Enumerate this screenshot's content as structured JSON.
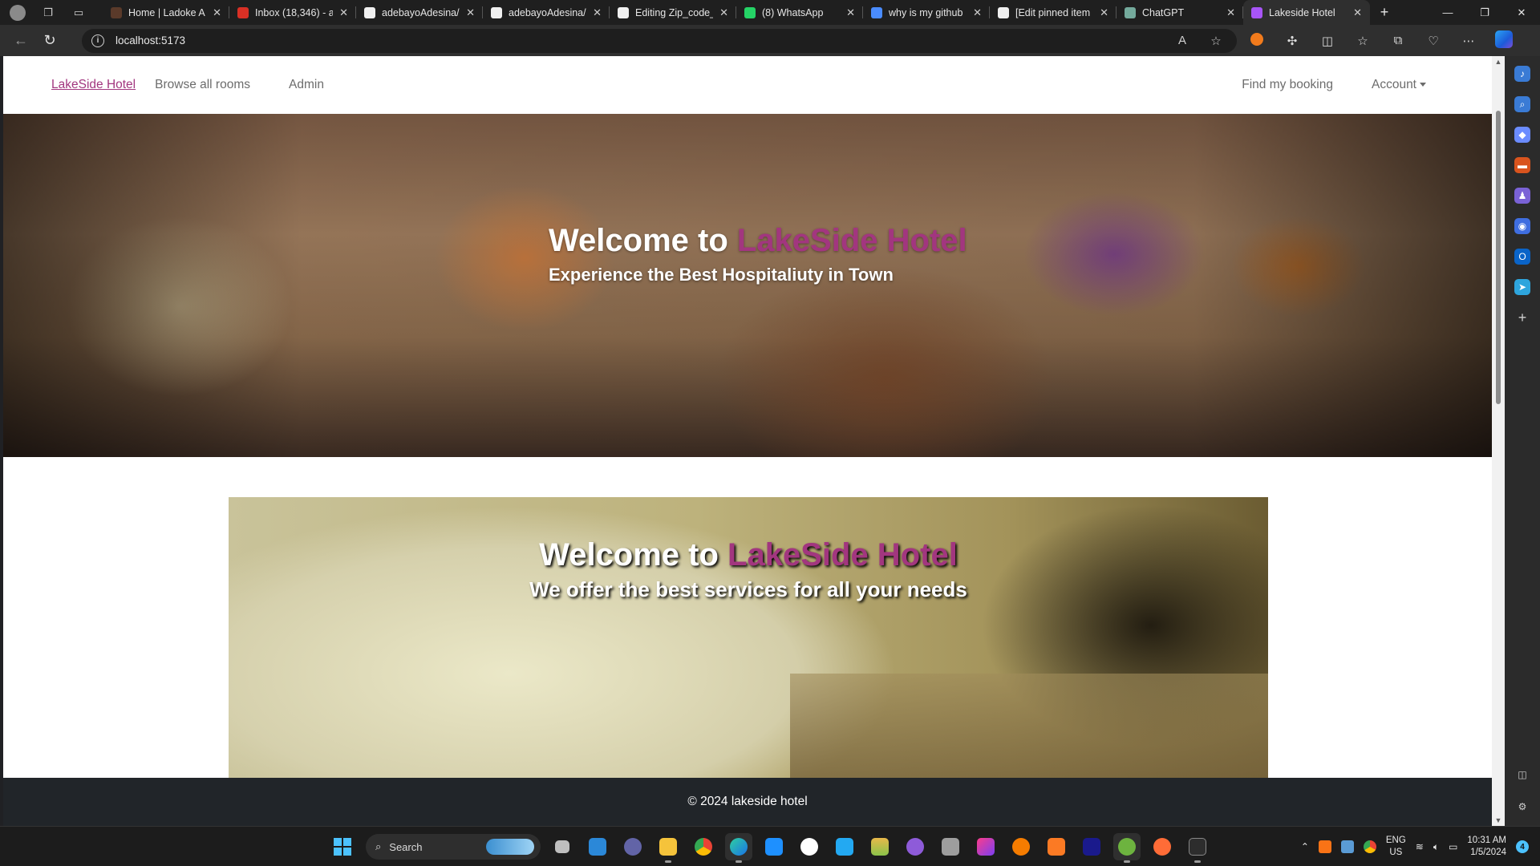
{
  "browser": {
    "tabs": [
      {
        "title": "Home | Ladoke A",
        "favicon": "ladoke-favicon",
        "color": "#5a3a2a"
      },
      {
        "title": "Inbox (18,346) - a",
        "favicon": "gmail-icon",
        "color": "#d93025"
      },
      {
        "title": "adebayoAdesina/",
        "favicon": "github-icon",
        "color": "#f0f0f0"
      },
      {
        "title": "adebayoAdesina/",
        "favicon": "github-icon",
        "color": "#f0f0f0"
      },
      {
        "title": "Editing Zip_code_",
        "favicon": "github-icon",
        "color": "#f0f0f0"
      },
      {
        "title": "(8) WhatsApp",
        "favicon": "whatsapp-icon",
        "color": "#25d366"
      },
      {
        "title": "why is my github",
        "favicon": "search-icon",
        "color": "#4a8cff"
      },
      {
        "title": "[Edit pinned item",
        "favicon": "github-icon",
        "color": "#f0f0f0"
      },
      {
        "title": "ChatGPT",
        "favicon": "chatgpt-icon",
        "color": "#74aa9c"
      },
      {
        "title": "Lakeside Hotel",
        "favicon": "vite-icon",
        "color": "#a855f7",
        "active": true
      }
    ],
    "url": "localhost:5173"
  },
  "site": {
    "brand": "LakeSide Hotel",
    "nav": {
      "browse": "Browse all rooms",
      "admin": "Admin",
      "find_booking": "Find my booking",
      "account": "Account"
    },
    "hero": {
      "title_prefix": "Welcome to ",
      "title_accent": "LakeSide Hotel",
      "subtitle": "Experience the Best Hospitaliuty in Town"
    },
    "banner": {
      "title_prefix": "Welcome to ",
      "title_accent": "LakeSide Hotel",
      "subtitle": "We offer the best services for all your needs"
    },
    "footer": "© 2024 lakeside hotel",
    "colors": {
      "accent": "#a2367f",
      "footer_bg": "#212529"
    }
  },
  "taskbar": {
    "search_placeholder": "Search",
    "lang_line1": "ENG",
    "lang_line2": "US",
    "time": "10:31 AM",
    "date": "1/5/2024",
    "notification_count": "4"
  }
}
